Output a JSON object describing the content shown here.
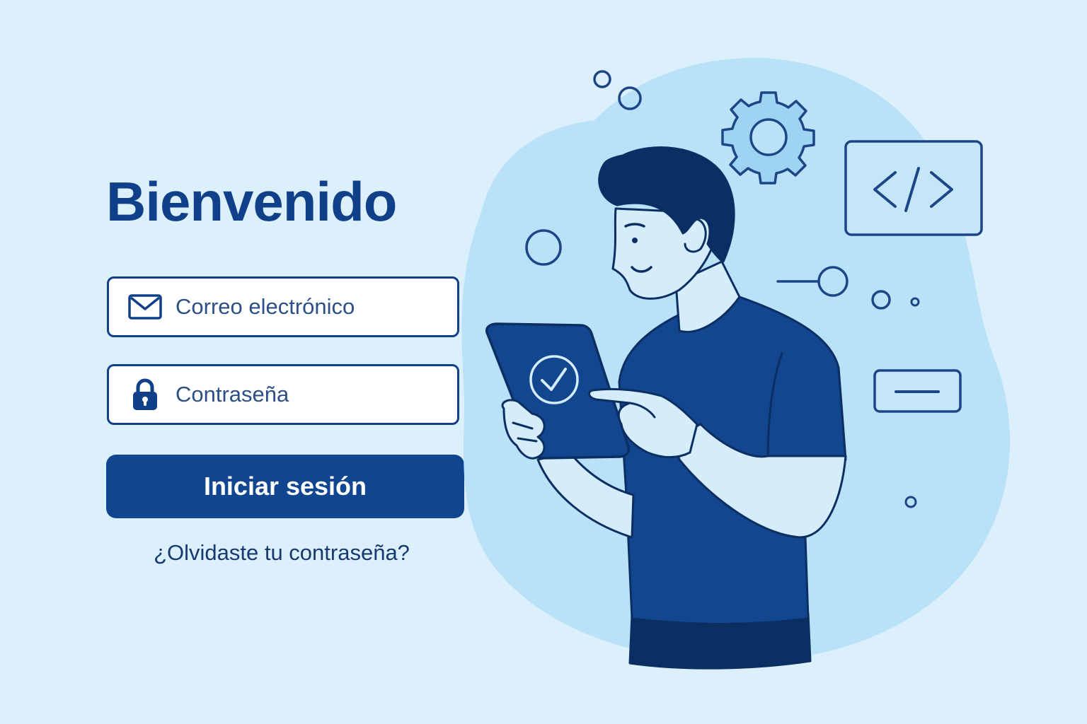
{
  "login": {
    "title": "Bienvenido",
    "email_placeholder": "Correo electrónico",
    "password_placeholder": "Contraseña",
    "submit_label": "Iniciar sesión",
    "forgot_link": "¿Olvidaste tu contraseña?"
  },
  "icons": {
    "email": "envelope-icon",
    "password": "lock-icon",
    "settings": "gear-icon",
    "code": "code-icon",
    "check": "check-circle-icon"
  },
  "colors": {
    "background": "#dcf0fc",
    "primary": "#10468f",
    "title": "#11408a",
    "blob": "#b9e1f7",
    "skin": "#d5edfa",
    "hair": "#0b2e63"
  }
}
